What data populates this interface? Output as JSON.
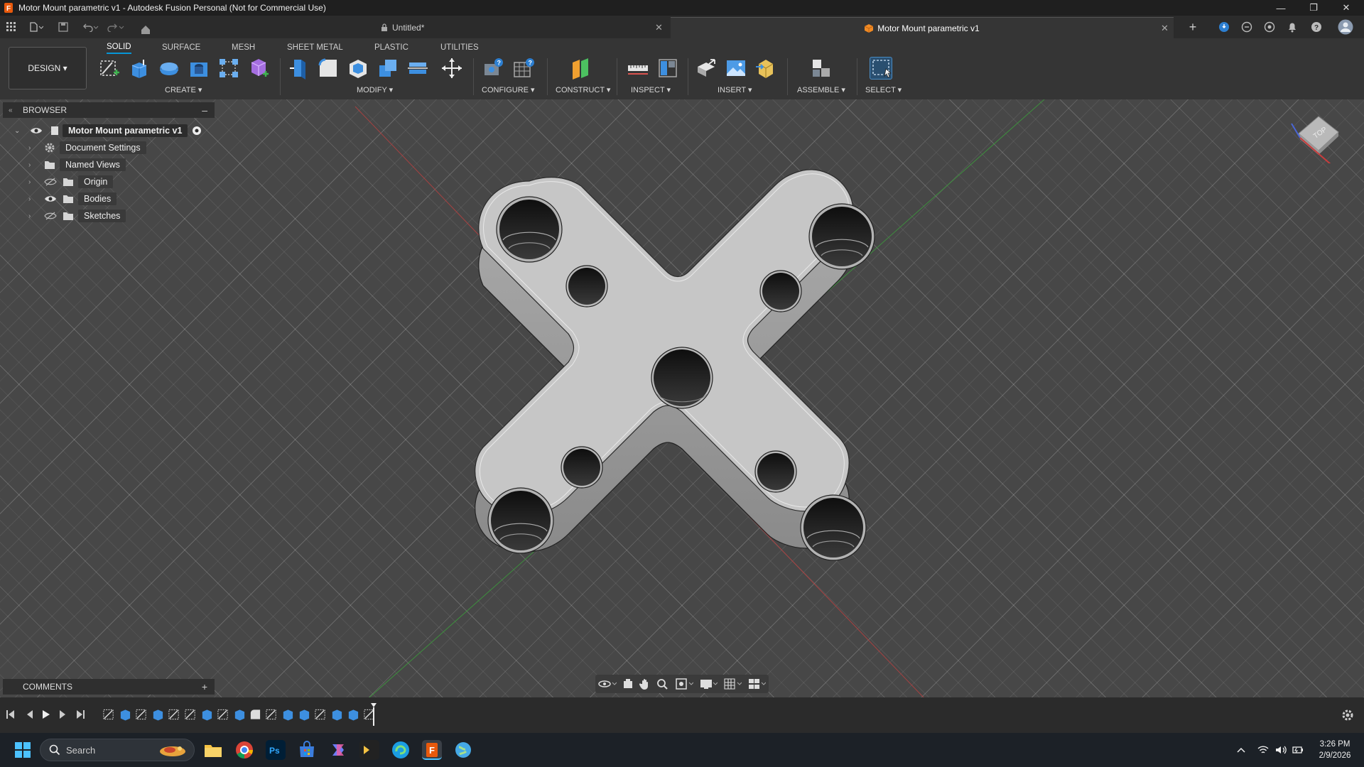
{
  "window": {
    "title": "Motor Mount parametric v1 - Autodesk Fusion Personal (Not for Commercial Use)",
    "minimize": "—",
    "restore": "❐",
    "close": "✕"
  },
  "tabs": [
    {
      "label": "Untitled*",
      "icon": "lock-icon",
      "close": "✕"
    },
    {
      "label": "Motor Mount parametric v1",
      "icon": "component-icon",
      "close": "✕"
    }
  ],
  "toolbar": {
    "workspace": "DESIGN ▾",
    "workspace_tabs": [
      "SOLID",
      "SURFACE",
      "MESH",
      "SHEET METAL",
      "PLASTIC",
      "UTILITIES"
    ],
    "groups": [
      "CREATE ▾",
      "MODIFY ▾",
      "CONFIGURE ▾",
      "CONSTRUCT ▾",
      "INSPECT ▾",
      "INSERT ▾",
      "ASSEMBLE ▾",
      "SELECT ▾"
    ]
  },
  "browser": {
    "header": "BROWSER",
    "collapse": "–",
    "root": "Motor Mount parametric v1",
    "items": [
      {
        "label": "Document Settings",
        "icon": "gear-icon"
      },
      {
        "label": "Named Views",
        "icon": "folder-icon"
      },
      {
        "label": "Origin",
        "icon": "folder-icon"
      },
      {
        "label": "Bodies",
        "icon": "folder-icon"
      },
      {
        "label": "Sketches",
        "icon": "folder-icon"
      }
    ]
  },
  "viewcube": {
    "face": "TOP"
  },
  "comments": {
    "header": "COMMENTS",
    "add": "+"
  },
  "taskbar": {
    "search_placeholder": "Search",
    "time": "3:26 PM",
    "date": "2/9/2026"
  },
  "colors": {
    "accent": "#0696d7",
    "part": "#c9c9c9",
    "fusion_orange": "#e8590c"
  }
}
